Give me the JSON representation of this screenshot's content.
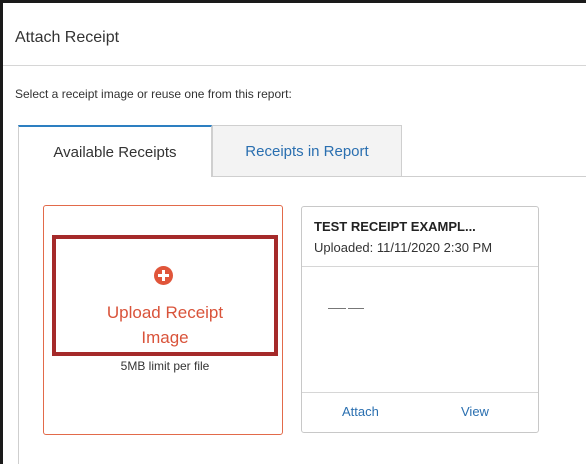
{
  "dialog": {
    "title": "Attach Receipt",
    "instructions": "Select a receipt image or reuse one from this report:"
  },
  "tabs": [
    {
      "label": "Available Receipts",
      "active": true
    },
    {
      "label": "Receipts in Report",
      "active": false
    }
  ],
  "upload_card": {
    "icon": "plus-circle-icon",
    "label_line1": "Upload Receipt",
    "label_line2": "Image",
    "limit": "5MB limit per file"
  },
  "receipt_card": {
    "name": "TEST RECEIPT EXAMPL...",
    "uploaded": "Uploaded: 11/11/2020 2:30 PM",
    "attach_label": "Attach",
    "view_label": "View"
  },
  "colors": {
    "accent_orange": "#e0553a",
    "link_blue": "#2a6fb0",
    "active_tab_top": "#2d7fc1",
    "highlight_box": "#a52a2a"
  }
}
